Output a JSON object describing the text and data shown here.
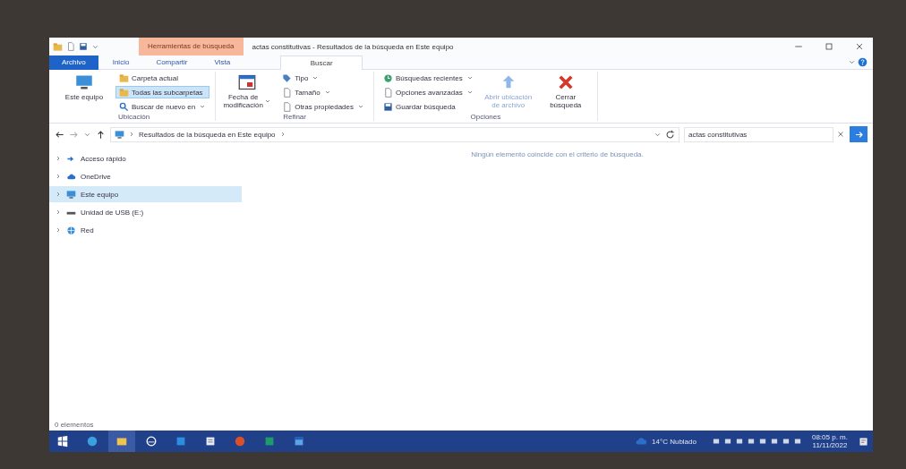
{
  "window": {
    "title": "actas constitutivas - Resultados de la búsqueda en Este equipo",
    "contextual_group": "Herramientas de búsqueda"
  },
  "tabs": [
    {
      "label": "Archivo",
      "kind": "file",
      "selected": false
    },
    {
      "label": "Inicio",
      "kind": "tab",
      "selected": false
    },
    {
      "label": "Compartir",
      "kind": "tab",
      "selected": false
    },
    {
      "label": "Vista",
      "kind": "tab",
      "selected": false
    },
    {
      "label": "Buscar",
      "kind": "contextual",
      "selected": true
    }
  ],
  "ribbon": {
    "groups": [
      {
        "label": "Ubicación",
        "items": [
          {
            "kind": "large",
            "label": "Este equipo",
            "dropdown": false
          },
          {
            "kind": "small",
            "label": "Carpeta actual",
            "dropdown": false,
            "selected": false
          },
          {
            "kind": "small",
            "label": "Todas las subcarpetas",
            "dropdown": false,
            "selected": true
          },
          {
            "kind": "small",
            "label": "Buscar de nuevo en",
            "dropdown": true,
            "selected": false
          }
        ]
      },
      {
        "label": "Refinar",
        "items": [
          {
            "kind": "large",
            "label": "Fecha de modificación",
            "dropdown": true
          },
          {
            "kind": "small",
            "label": "Tipo",
            "dropdown": true,
            "selected": false
          },
          {
            "kind": "small",
            "label": "Tamaño",
            "dropdown": true,
            "selected": false
          },
          {
            "kind": "small",
            "label": "Otras propiedades",
            "dropdown": true,
            "selected": false
          }
        ]
      },
      {
        "label": "Opciones",
        "items": [
          {
            "kind": "small",
            "label": "Búsquedas recientes",
            "dropdown": true,
            "selected": false
          },
          {
            "kind": "small",
            "label": "Opciones avanzadas",
            "dropdown": true,
            "selected": false
          },
          {
            "kind": "small",
            "label": "Guardar búsqueda",
            "dropdown": false,
            "selected": false
          },
          {
            "kind": "large",
            "label": "Abrir ubicación de archivo",
            "dropdown": false,
            "disabled": true
          },
          {
            "kind": "large",
            "label": "Cerrar búsqueda",
            "dropdown": false,
            "disabled": false
          }
        ]
      }
    ]
  },
  "address": {
    "path": "Resultados de la búsqueda en Este equipo"
  },
  "search": {
    "value": "actas constitutivas"
  },
  "nav": [
    {
      "label": "Acceso rápido",
      "selected": false
    },
    {
      "label": "OneDrive",
      "selected": false
    },
    {
      "label": "Este equipo",
      "selected": true
    },
    {
      "label": "Unidad de USB (E:)",
      "selected": false
    },
    {
      "label": "Red",
      "selected": false
    }
  ],
  "content": {
    "message": "Ningún elemento coincide con el criterio de búsqueda."
  },
  "status_bar": {
    "count": "0 elementos"
  },
  "taskbar": {
    "weather": "14°C Nublado",
    "time": "08:05 p. m.",
    "date": "11/11/2022"
  }
}
